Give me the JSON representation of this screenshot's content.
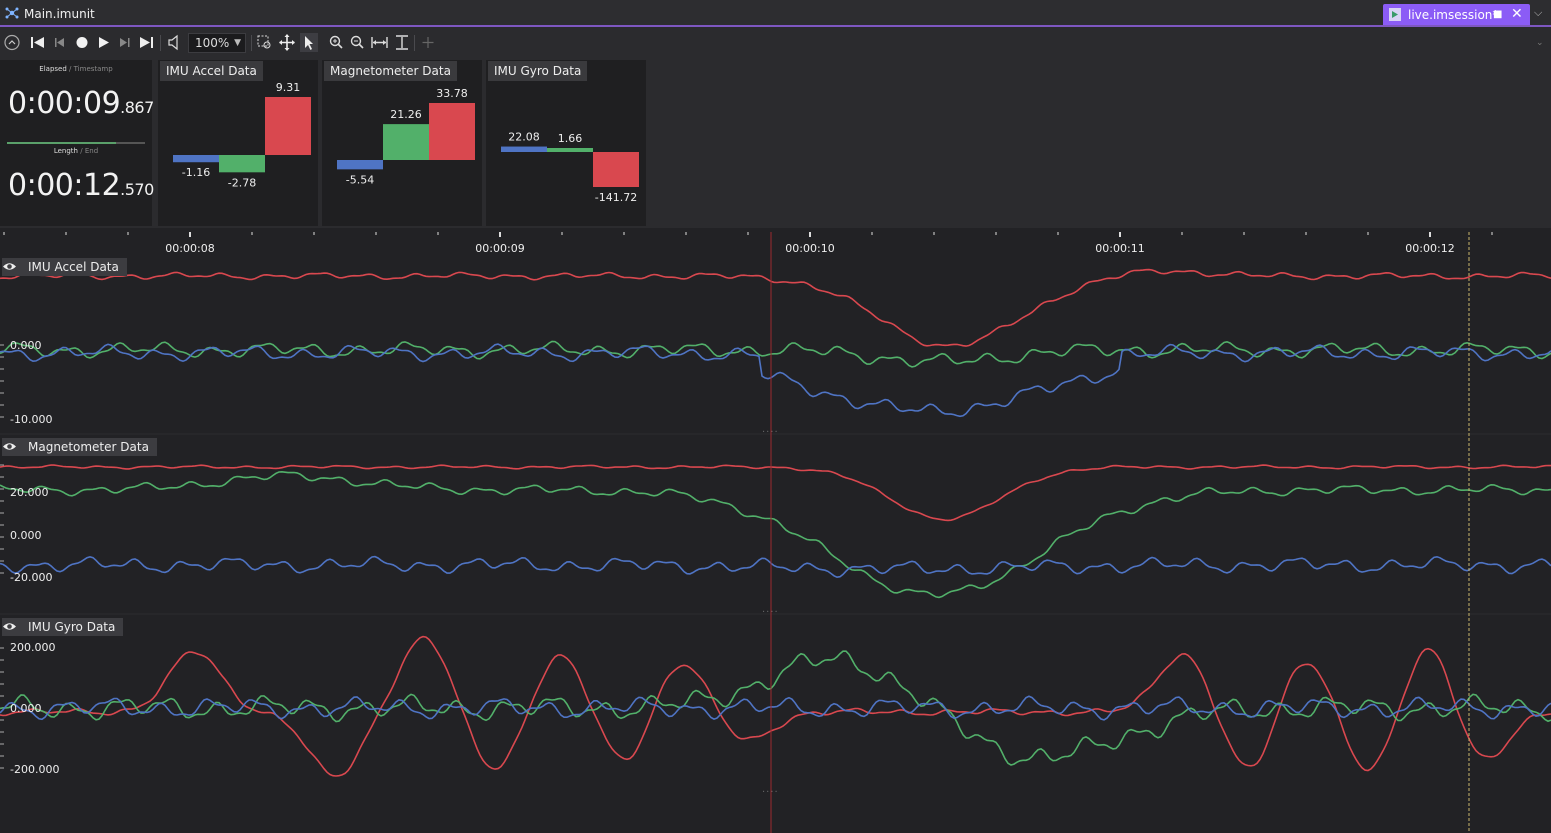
{
  "window": {
    "title": "Main.imunit",
    "session_tab": "live.imsession*"
  },
  "toolbar": {
    "zoom": "100%"
  },
  "time": {
    "elapsed_label": "Elapsed",
    "timestamp_label": "Timestamp",
    "elapsed_main": "0:00:09",
    "elapsed_ms": ".867",
    "length_label": "Length",
    "end_label": "End",
    "length_main": "0:00:12",
    "length_ms": ".570",
    "progress": 0.79
  },
  "bar_panels": [
    {
      "title": "IMU Accel Data",
      "values": [
        -1.16,
        -2.78,
        9.31
      ],
      "labels": [
        "-1.16",
        "-2.78",
        "9.31"
      ]
    },
    {
      "title": "Magnetometer Data",
      "values": [
        -5.54,
        21.26,
        33.78
      ],
      "labels": [
        "-5.54",
        "21.26",
        "33.78"
      ]
    },
    {
      "title": "IMU Gyro Data",
      "values": [
        22.08,
        1.66,
        -141.72
      ],
      "labels": [
        "22.08",
        "1.66",
        "-141.72"
      ]
    }
  ],
  "timeline": {
    "ticks": [
      "00:00:08",
      "00:00:09",
      "00:00:10",
      "00:00:11",
      "00:00:12"
    ]
  },
  "tracks": [
    {
      "title": "IMU Accel Data",
      "yticks": [
        "0.000",
        "-10.000"
      ]
    },
    {
      "title": "Magnetometer Data",
      "yticks": [
        "20.000",
        "0.000",
        "-20.000"
      ]
    },
    {
      "title": "IMU Gyro Data",
      "yticks": [
        "200.000",
        "0.000",
        "-200.000"
      ]
    }
  ],
  "colors": {
    "x": "#4f74c4",
    "y": "#52b06a",
    "z": "#d9484f",
    "accent": "#8b5cf6"
  },
  "chart_data": {
    "type": "line",
    "x_range_seconds": [
      7.6,
      12.6
    ],
    "charts": [
      {
        "title": "IMU Accel Data",
        "ylim": [
          -10,
          10
        ]
      },
      {
        "title": "Magnetometer Data",
        "ylim": [
          -35,
          35
        ]
      },
      {
        "title": "IMU Gyro Data",
        "ylim": [
          -250,
          250
        ]
      }
    ]
  }
}
